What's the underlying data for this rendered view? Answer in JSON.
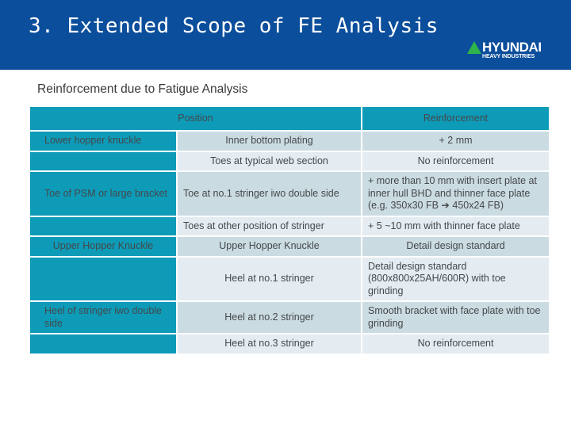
{
  "banner": {
    "title": "3. Extended Scope of FE Analysis",
    "background_color": "#0B4E9B"
  },
  "logo": {
    "name": "HYUNDAI",
    "tagline": "HEAVY INDUSTRIES",
    "triangle_color": "#2EB44A"
  },
  "subtitle": "Reinforcement due to Fatigue Analysis",
  "table": {
    "accent_color": "#0E9BB8",
    "row_color_dark": "#CBDBE2",
    "row_color_light": "#E4EBF1",
    "headers": {
      "position": "Position",
      "reinforcement": "Reinforcement"
    },
    "rows": [
      {
        "category": "Lower hopper knuckle",
        "category_shown": true,
        "category_align": "left",
        "position": "Inner bottom plating",
        "position_align": "center",
        "reinforcement": "+ 2 mm",
        "reinforcement_align": "center",
        "shade": "dark"
      },
      {
        "category": "",
        "category_shown": false,
        "category_align": "center",
        "position": "Toes at typical web section",
        "position_align": "center",
        "reinforcement": "No reinforcement",
        "reinforcement_align": "center",
        "shade": "light"
      },
      {
        "category": "Toe of PSM or large bracket",
        "category_shown": true,
        "category_align": "left",
        "position": "Toe at no.1 stringer iwo double side",
        "position_align": "left",
        "reinforcement": "+ more than 10 mm with insert plate at inner hull BHD and thinner face plate (e.g. 350x30 FB ➔ 450x24 FB)",
        "reinforcement_align": "left",
        "shade": "dark"
      },
      {
        "category": "",
        "category_shown": false,
        "category_align": "center",
        "position": "Toes at other position of stringer",
        "position_align": "left",
        "reinforcement": "+ 5 ~10 mm with thinner face plate",
        "reinforcement_align": "left",
        "shade": "light"
      },
      {
        "category": "Upper Hopper Knuckle",
        "category_shown": true,
        "category_align": "center",
        "position": "Upper Hopper Knuckle",
        "position_align": "center",
        "reinforcement": "Detail design standard",
        "reinforcement_align": "center",
        "shade": "dark"
      },
      {
        "category": "",
        "category_shown": false,
        "category_align": "center",
        "position": "Heel at no.1 stringer",
        "position_align": "center",
        "reinforcement": "Detail design standard (800x800x25AH/600R) with toe grinding",
        "reinforcement_align": "left",
        "shade": "light"
      },
      {
        "category": "Heel of stringer iwo double side",
        "category_shown": true,
        "category_align": "left",
        "position": "Heel at no.2 stringer",
        "position_align": "center",
        "reinforcement": "Smooth bracket with face plate with toe grinding",
        "reinforcement_align": "left",
        "shade": "dark"
      },
      {
        "category": "",
        "category_shown": false,
        "category_align": "center",
        "position": "Heel at no.3 stringer",
        "position_align": "center",
        "reinforcement": "No reinforcement",
        "reinforcement_align": "center",
        "shade": "light"
      }
    ]
  }
}
